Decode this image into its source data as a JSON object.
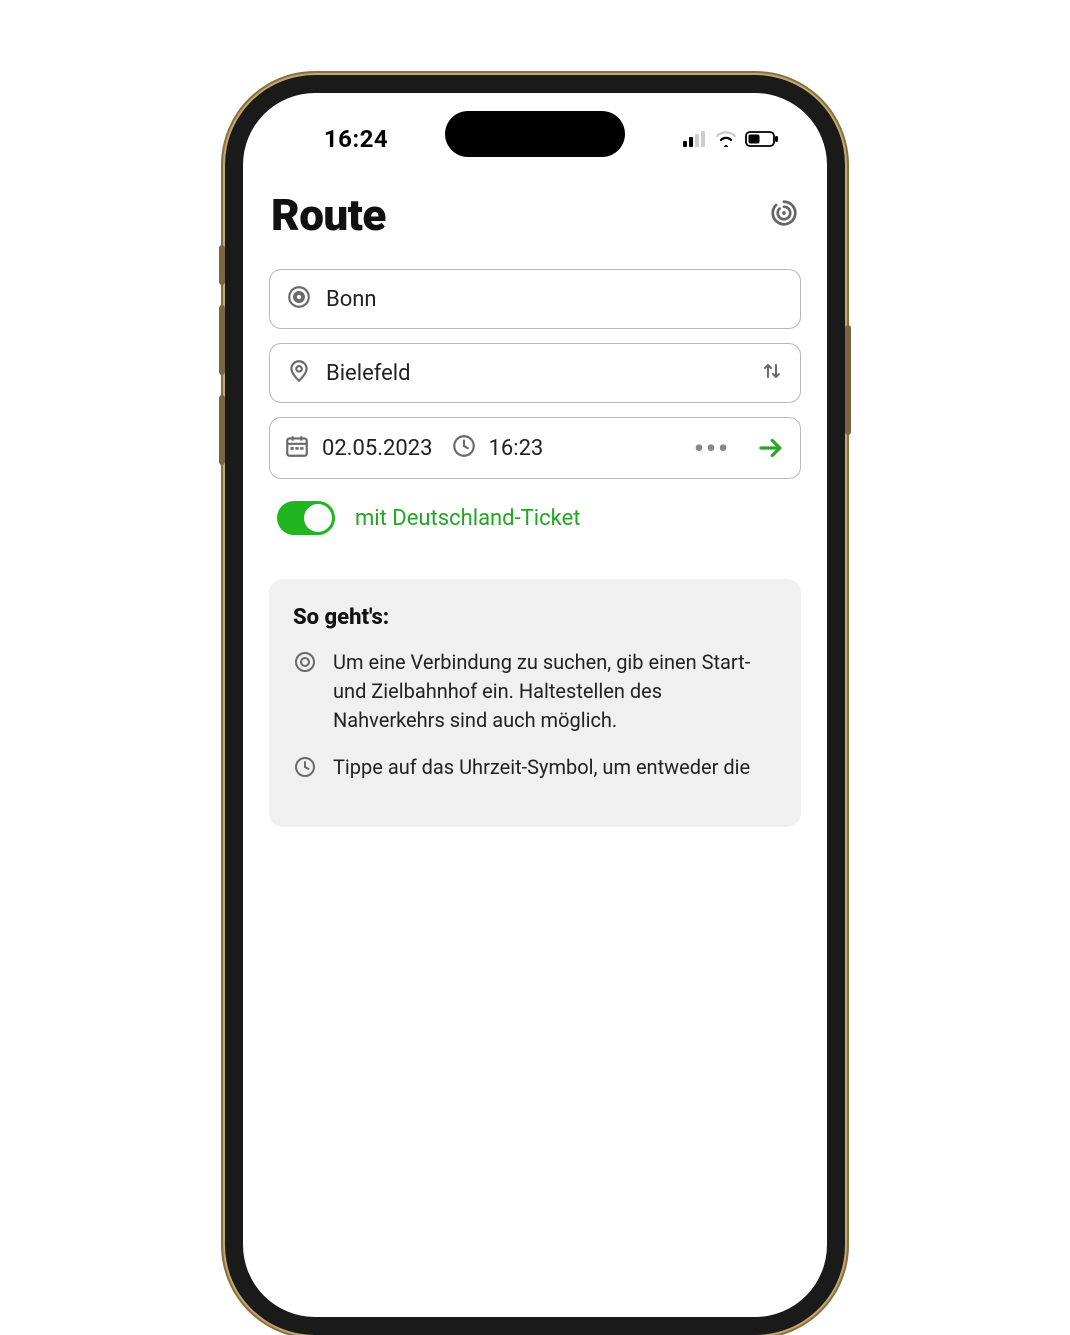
{
  "status": {
    "time": "16:24"
  },
  "header": {
    "title": "Route"
  },
  "route": {
    "origin": "Bonn",
    "destination": "Bielefeld",
    "date": "02.05.2023",
    "time": "16:23",
    "more": "•••"
  },
  "ticket_toggle": {
    "label": "mit Deutschland-Ticket",
    "enabled": true
  },
  "info": {
    "title": "So geht's:",
    "items": [
      "Um eine Verbindung zu suchen, gib einen Start- und Zielbahnhof ein. Haltestellen des Nahverkehrs sind auch möglich.",
      "Tippe auf das Uhrzeit-Symbol, um entweder die"
    ]
  }
}
